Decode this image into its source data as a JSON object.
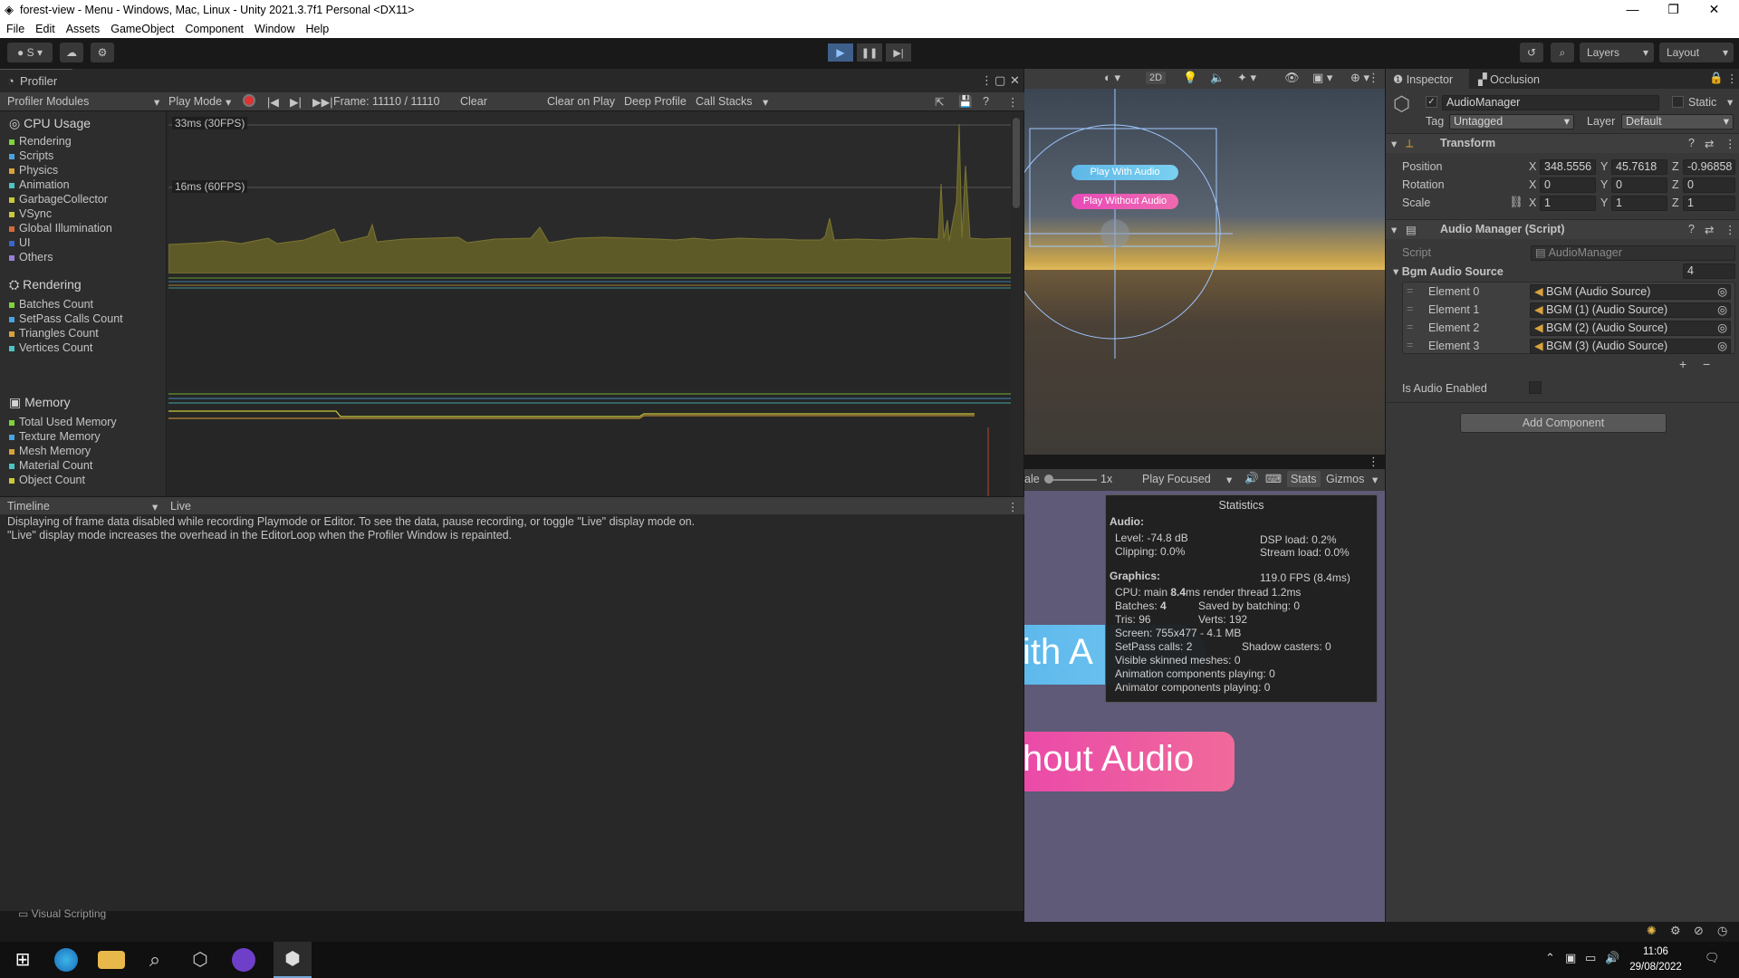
{
  "window": {
    "title": "forest-view - Menu - Windows, Mac, Linux - Unity 2021.3.7f1 Personal <DX11>",
    "controls": [
      "—",
      "❐",
      "✕"
    ]
  },
  "menu": [
    "File",
    "Edit",
    "Assets",
    "GameObject",
    "Component",
    "Window",
    "Help"
  ],
  "toolbar": {
    "account": "S",
    "layers": "Layers",
    "layout": "Layout"
  },
  "profiler": {
    "tab": "Profiler",
    "modules_label": "Profiler Modules",
    "play_mode": "Play Mode",
    "frame": "Frame: 11110 / 11110",
    "clear": "Clear",
    "clear_on_play": "Clear on Play",
    "deep_profile": "Deep Profile",
    "call_stacks": "Call Stacks",
    "cpu_header": "CPU Usage",
    "cpu_items": [
      {
        "label": "Rendering",
        "color": "#7fd43a"
      },
      {
        "label": "Scripts",
        "color": "#4aa3df"
      },
      {
        "label": "Physics",
        "color": "#d9a23a"
      },
      {
        "label": "Animation",
        "color": "#4dc3c3"
      },
      {
        "label": "GarbageCollector",
        "color": "#c9c93a"
      },
      {
        "label": "VSync",
        "color": "#c9c93a"
      },
      {
        "label": "Global Illumination",
        "color": "#d46a3a"
      },
      {
        "label": "UI",
        "color": "#3a66c9"
      },
      {
        "label": "Others",
        "color": "#9a7fd4"
      }
    ],
    "fps33": "33ms (30FPS)",
    "fps16": "16ms (60FPS)",
    "rendering_header": "Rendering",
    "rendering_items": [
      {
        "label": "Batches Count",
        "color": "#7fd43a"
      },
      {
        "label": "SetPass Calls Count",
        "color": "#4aa3df"
      },
      {
        "label": "Triangles Count",
        "color": "#d9a23a"
      },
      {
        "label": "Vertices Count",
        "color": "#4dc3c3"
      }
    ],
    "memory_header": "Memory",
    "memory_items": [
      {
        "label": "Total Used Memory",
        "color": "#7fd43a"
      },
      {
        "label": "Texture Memory",
        "color": "#4aa3df"
      },
      {
        "label": "Mesh Memory",
        "color": "#d9a23a"
      },
      {
        "label": "Material Count",
        "color": "#4dc3c3"
      },
      {
        "label": "Object Count",
        "color": "#c9c93a"
      }
    ],
    "timeline": "Timeline",
    "live": "Live",
    "message1": "Displaying of frame data disabled while recording Playmode or Editor. To see the data, pause recording, or toggle \"Live\" display mode on.",
    "message2": "\"Live\" display mode increases the overhead in the EditorLoop when the Profiler Window is repainted.",
    "visual_scripting": "Visual Scripting"
  },
  "scene": {
    "btn_2d": "2D",
    "play_with_audio": "Play With Audio",
    "play_without_audio": "Play Without Audio"
  },
  "game": {
    "scale_label": "ale",
    "scale_value": "1x",
    "play_focused": "Play Focused",
    "stats": "Stats",
    "gizmos": "Gizmos",
    "big_btn1": "ith A",
    "big_btn2": "hout Audio"
  },
  "statistics": {
    "title": "Statistics",
    "audio_hdr": "Audio:",
    "level": "Level: -74.8 dB",
    "dsp": "DSP load: 0.2%",
    "clipping": "Clipping: 0.0%",
    "stream": "Stream load: 0.0%",
    "graphics_hdr": "Graphics:",
    "fps": "119.0 FPS (8.4ms)",
    "cpu_a": "CPU: main ",
    "cpu_b": "8.4",
    "cpu_c": "ms  render thread 1.2ms",
    "batches_a": "Batches: ",
    "batches_b": "4",
    "saved": "Saved by batching: 0",
    "tris": "Tris: 96",
    "verts": "Verts: 192",
    "screen": "Screen: 755x477 - 4.1 MB",
    "setpass": "SetPass calls: 2",
    "shadow": "Shadow casters: 0",
    "skinned": "Visible skinned meshes: 0",
    "anim": "Animation components playing: 0",
    "animator": "Animator components playing: 0"
  },
  "inspector": {
    "tab": "Inspector",
    "tab2": "Occlusion",
    "object_name": "AudioManager",
    "static": "Static",
    "tag_label": "Tag",
    "tag_value": "Untagged",
    "layer_label": "Layer",
    "layer_value": "Default",
    "transform": "Transform",
    "position_label": "Position",
    "position": {
      "x": "348.5556",
      "y": "45.7618",
      "z": "-0.96858"
    },
    "rotation_label": "Rotation",
    "rotation": {
      "x": "0",
      "y": "0",
      "z": "0"
    },
    "scale_label": "Scale",
    "scale": {
      "x": "1",
      "y": "1",
      "z": "1"
    },
    "script_component": "Audio Manager (Script)",
    "script_label": "Script",
    "script_value": "AudioManager",
    "bgm_label": "Bgm Audio Source",
    "bgm_count": "4",
    "elements": [
      {
        "label": "Element 0",
        "value": "BGM (Audio Source)"
      },
      {
        "label": "Element 1",
        "value": "BGM (1) (Audio Source)"
      },
      {
        "label": "Element 2",
        "value": "BGM (2) (Audio Source)"
      },
      {
        "label": "Element 3",
        "value": "BGM (3) (Audio Source)"
      }
    ],
    "is_audio_enabled": "Is Audio Enabled",
    "add_component": "Add Component"
  },
  "taskbar": {
    "time": "11:06",
    "date": "29/08/2022"
  }
}
